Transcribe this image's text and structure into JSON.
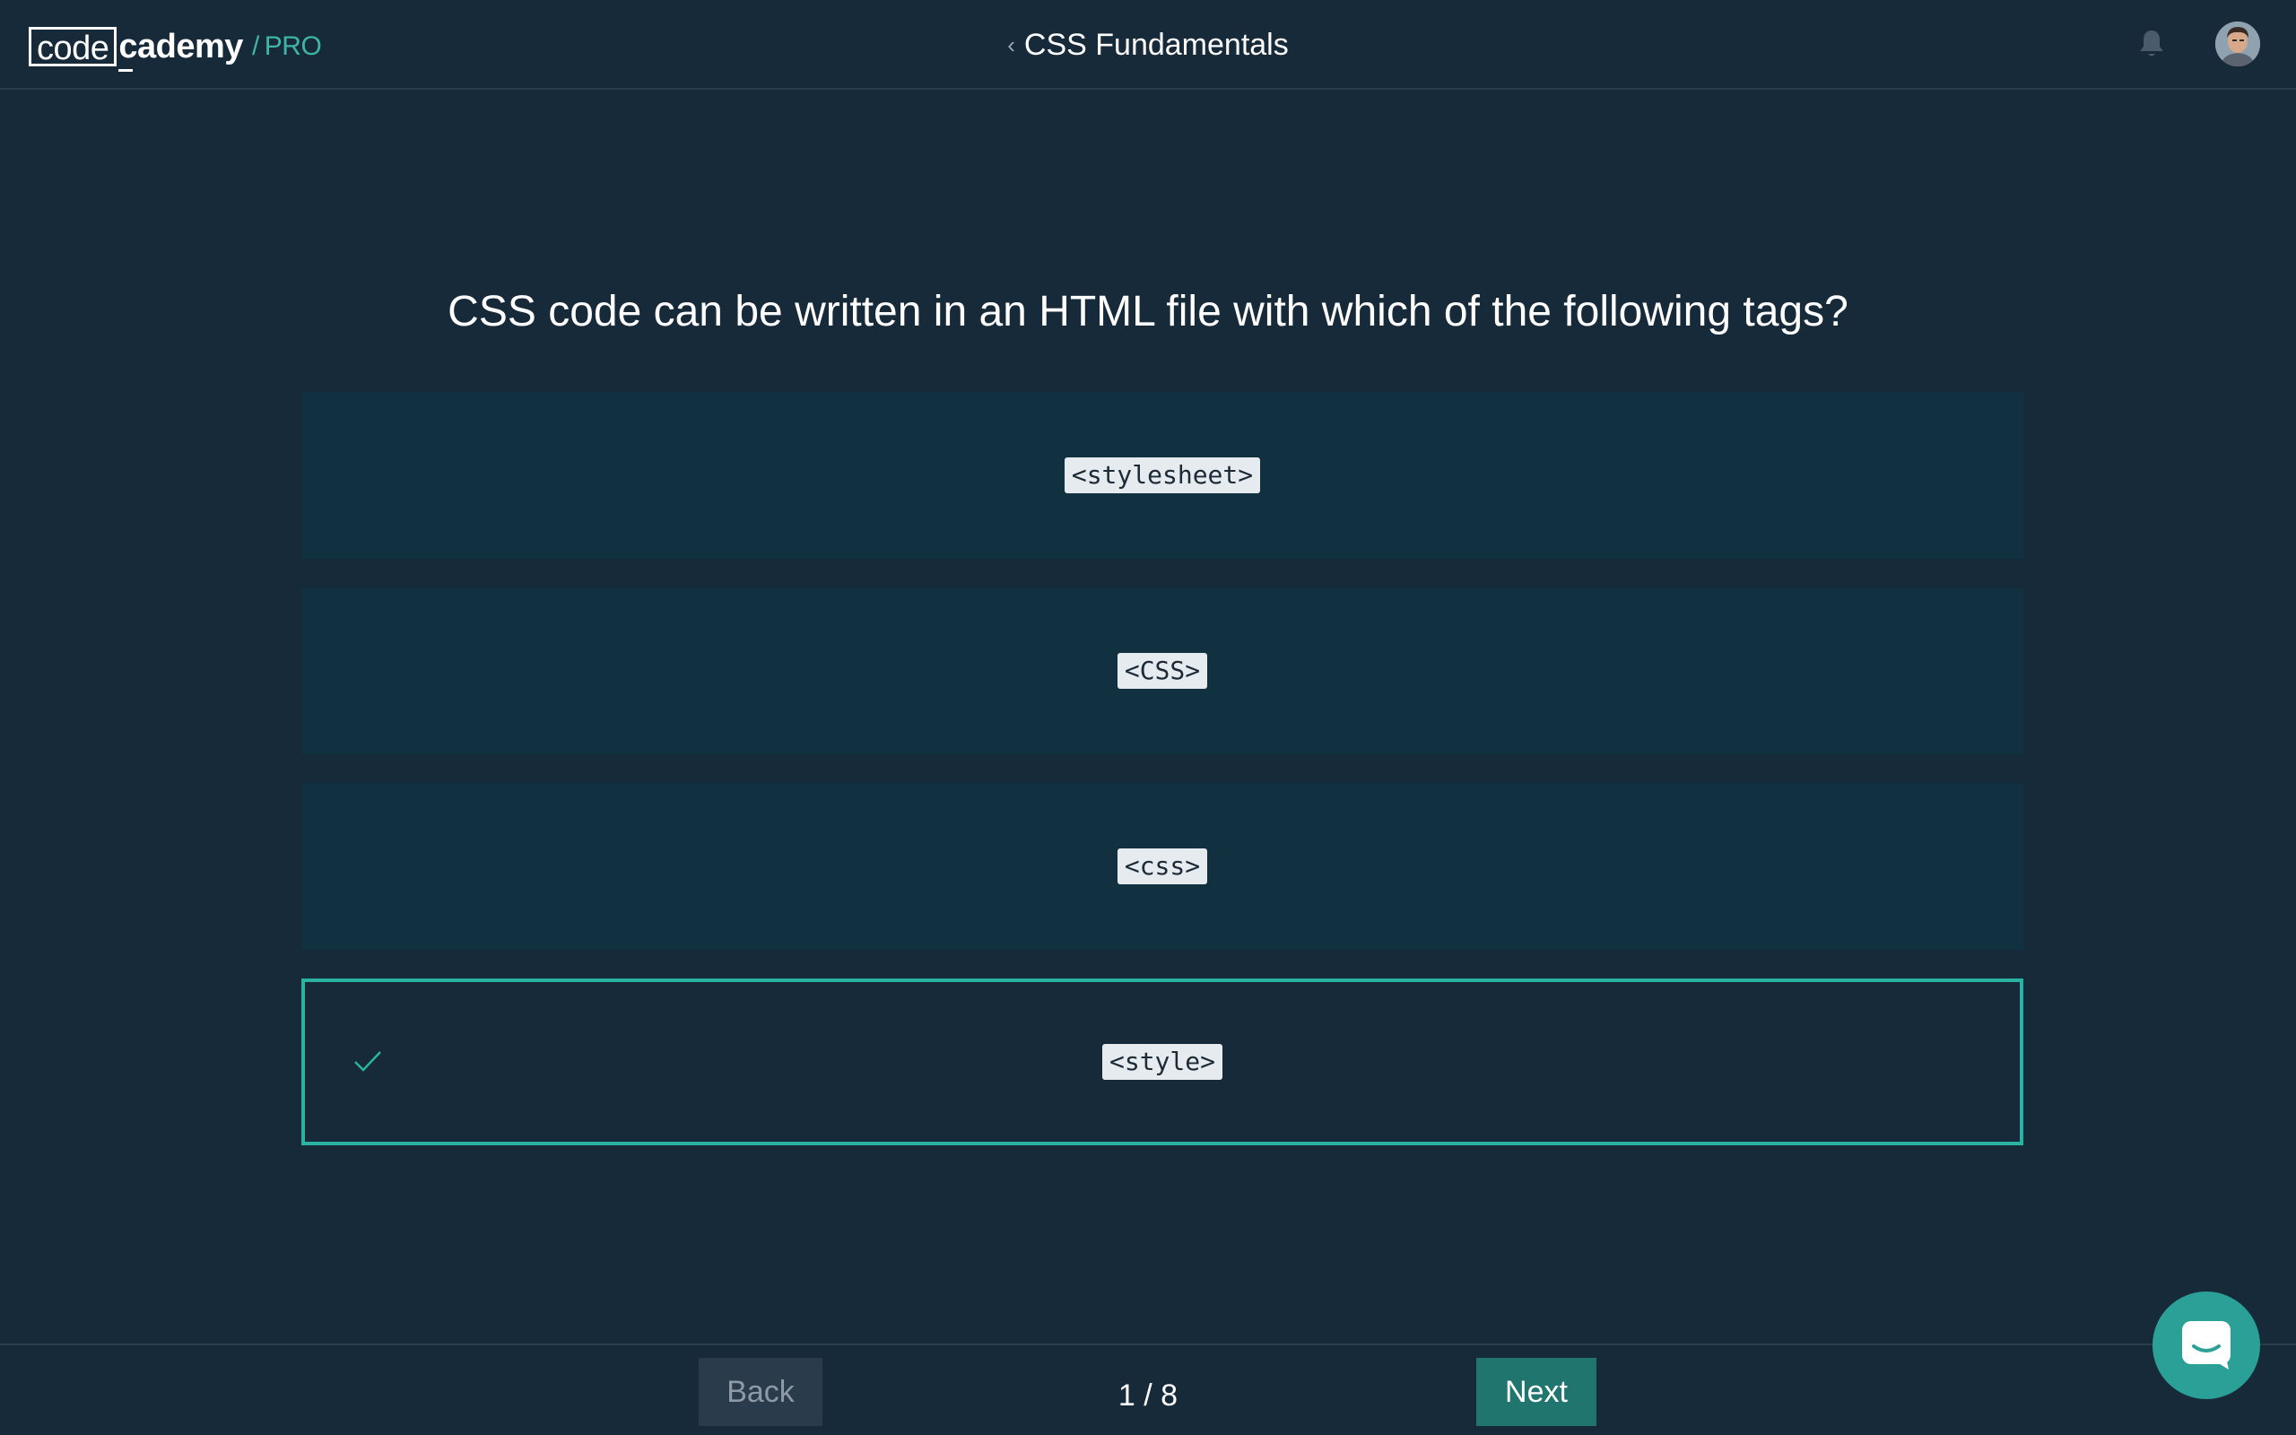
{
  "header": {
    "logo_code": "code",
    "logo_rest": "cademy",
    "logo_slash": "/",
    "logo_pro": "PRO",
    "course_title": "CSS Fundamentals",
    "back_chevron": "‹"
  },
  "quiz": {
    "question": "CSS code can be written in an HTML file with which of the following tags?",
    "options": [
      {
        "label": "<stylesheet>",
        "selected": false
      },
      {
        "label": "<CSS>",
        "selected": false
      },
      {
        "label": "<css>",
        "selected": false
      },
      {
        "label": "<style>",
        "selected": true
      }
    ]
  },
  "footer": {
    "back_label": "Back",
    "next_label": "Next",
    "progress": "1 / 8"
  },
  "colors": {
    "background": "#172a3a",
    "option_background": "#123140",
    "accent": "#2bb3a1",
    "next_button": "#20766e",
    "pro_label": "#3eb5a8"
  },
  "icons": {
    "notifications": "bell-icon",
    "profile": "avatar",
    "selected_answer": "checkmark-icon",
    "support": "chat-icon"
  }
}
